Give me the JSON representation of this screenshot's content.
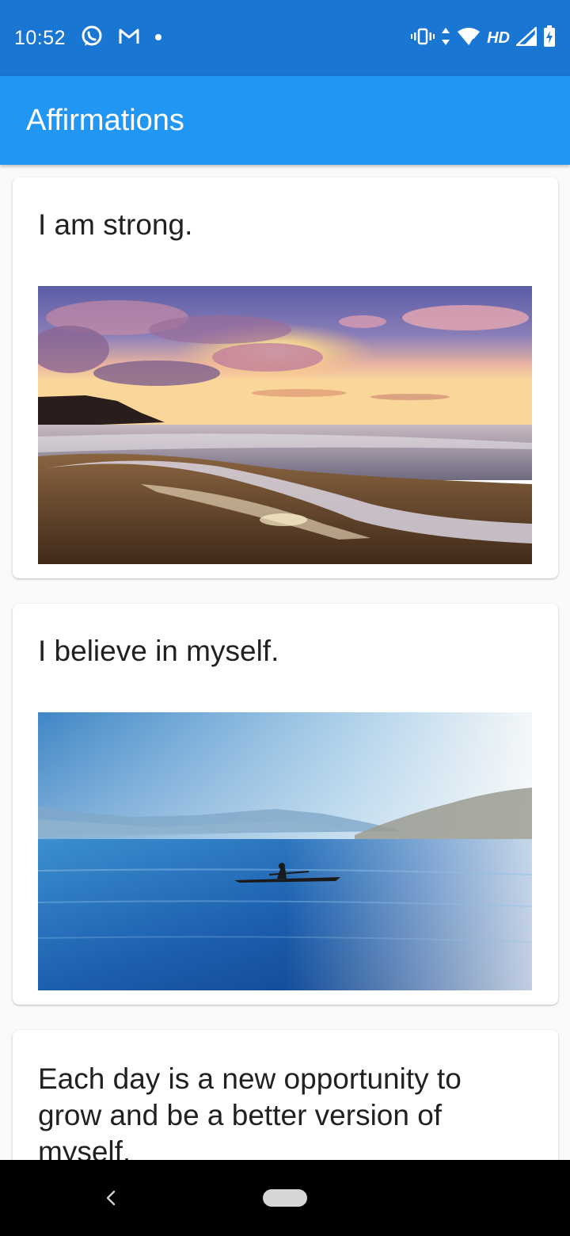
{
  "status_bar": {
    "time": "10:52",
    "left_icons": [
      "whatsapp-icon",
      "gmail-icon",
      "notification-dot-icon"
    ],
    "right_icons": [
      "vibrate-icon",
      "data-arrows-icon",
      "wifi-icon",
      "cell-signal-icon",
      "battery-charging-icon"
    ],
    "network_label": "HD"
  },
  "app_bar": {
    "title": "Affirmations",
    "color": "#2196f3",
    "status_color": "#1976d2"
  },
  "affirmations": [
    {
      "text": "I am strong.",
      "image": "beach-sunset-image"
    },
    {
      "text": "I believe in myself.",
      "image": "lake-kayak-image"
    },
    {
      "text": "Each day is a new opportunity to grow and be a better version of myself."
    }
  ],
  "nav_bar": {
    "icons": [
      "back-icon",
      "home-pill-icon"
    ]
  }
}
